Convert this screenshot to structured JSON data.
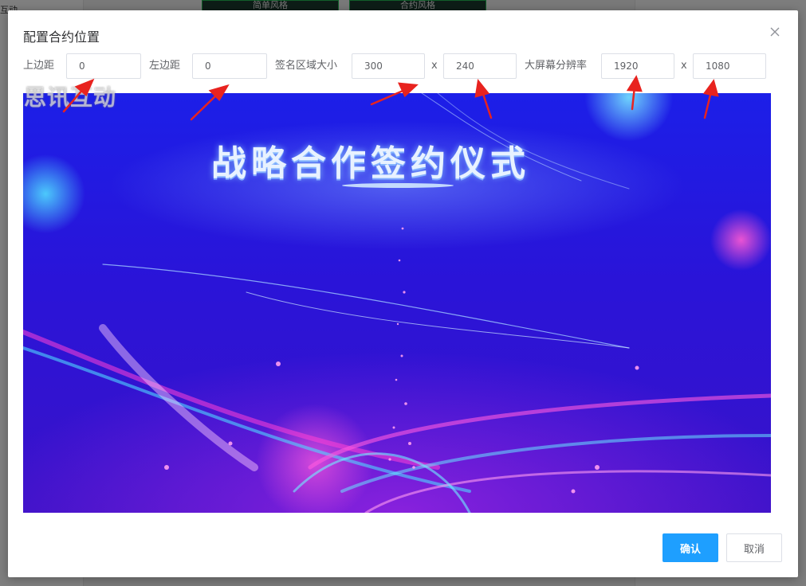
{
  "background": {
    "sidebar_text": "互动",
    "cards": [
      "简单风格",
      "合约风格"
    ]
  },
  "dialog": {
    "title": "配置合约位置",
    "close_icon": "close-icon",
    "fields": {
      "top_margin": {
        "label": "上边距",
        "value": "0"
      },
      "left_margin": {
        "label": "左边距",
        "value": "0"
      },
      "sign_area": {
        "label": "签名区域大小",
        "width": "300",
        "height": "240"
      },
      "screen_resolution": {
        "label": "大屏幕分辨率",
        "width": "1920",
        "height": "1080"
      },
      "separator": "x"
    },
    "preview": {
      "watermark": "思讯互动",
      "title": "战略合作签约仪式"
    },
    "buttons": {
      "confirm": "确认",
      "cancel": "取消"
    }
  },
  "colors": {
    "primary": "#1e9fff",
    "annotation_arrow": "#e8231f",
    "preview_bg": "#1c1fe8"
  }
}
